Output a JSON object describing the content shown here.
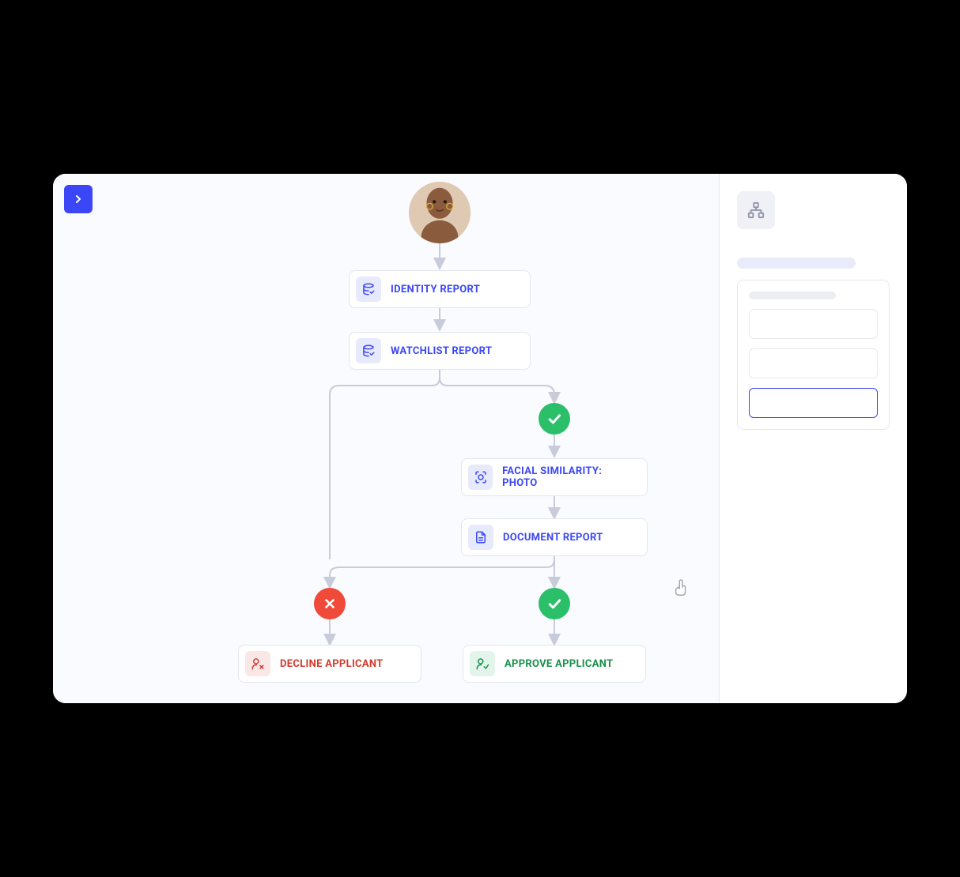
{
  "flow": {
    "nodes": {
      "identity_report": "IDENTITY REPORT",
      "watchlist_report": "WATCHLIST REPORT",
      "facial_similarity": "FACIAL SIMILARITY: PHOTO",
      "document_report": "DOCUMENT REPORT",
      "decline_applicant": "DECLINE APPLICANT",
      "approve_applicant": "APPROVE APPLICANT"
    },
    "icons": {
      "identity_report": "database-check-icon",
      "watchlist_report": "database-check-icon",
      "facial_similarity": "face-scan-icon",
      "document_report": "document-icon",
      "decline_applicant": "person-x-icon",
      "approve_applicant": "person-check-icon"
    }
  },
  "colors": {
    "primary": "#3B47F7",
    "success": "#2bbf6a",
    "danger": "#ef4a3a"
  }
}
